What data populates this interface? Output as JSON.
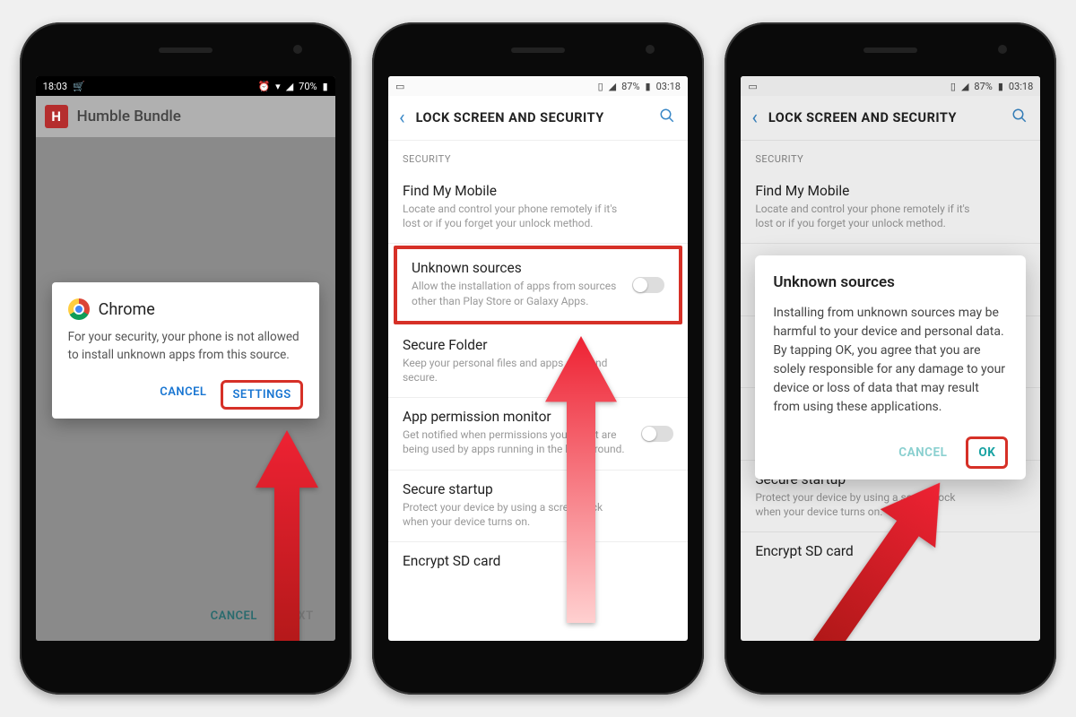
{
  "phone1": {
    "statusbar": {
      "time": "18:03",
      "battery": "70%"
    },
    "appbar": {
      "icon_letter": "H",
      "title": "Humble Bundle"
    },
    "dialog": {
      "app": "Chrome",
      "message": "For your security, your phone is not allowed to install unknown apps from this source.",
      "cancel": "CANCEL",
      "settings": "SETTINGS"
    },
    "bottom": {
      "cancel": "CANCEL",
      "next": "NEXT"
    }
  },
  "phone2": {
    "statusbar": {
      "battery": "87%",
      "time": "03:18"
    },
    "appbar": {
      "title": "LOCK SCREEN AND SECURITY"
    },
    "section": "SECURITY",
    "items": [
      {
        "title": "Find My Mobile",
        "desc": "Locate and control your phone remotely if it's lost or if you forget your unlock method.",
        "toggle": false,
        "highlight": false
      },
      {
        "title": "Unknown sources",
        "desc": "Allow the installation of apps from sources other than Play Store or Galaxy Apps.",
        "toggle": true,
        "highlight": true
      },
      {
        "title": "Secure Folder",
        "desc": "Keep your personal files and apps safe and secure.",
        "toggle": false,
        "highlight": false
      },
      {
        "title": "App permission monitor",
        "desc": "Get notified when permissions you select are being used by apps running in the background.",
        "toggle": true,
        "highlight": false
      },
      {
        "title": "Secure startup",
        "desc": "Protect your device by using a screen lock when your device turns on.",
        "toggle": false,
        "highlight": false
      },
      {
        "title": "Encrypt SD card",
        "desc": "",
        "toggle": false,
        "highlight": false
      }
    ]
  },
  "phone3": {
    "statusbar": {
      "battery": "87%",
      "time": "03:18"
    },
    "appbar": {
      "title": "LOCK SCREEN AND SECURITY"
    },
    "section": "SECURITY",
    "dialog": {
      "title": "Unknown sources",
      "message": "Installing from unknown sources may be harmful to your device and personal data. By tapping OK, you agree that you are solely responsible for any damage to your device or loss of data that may result from using these applications.",
      "cancel": "CANCEL",
      "ok": "OK"
    }
  }
}
